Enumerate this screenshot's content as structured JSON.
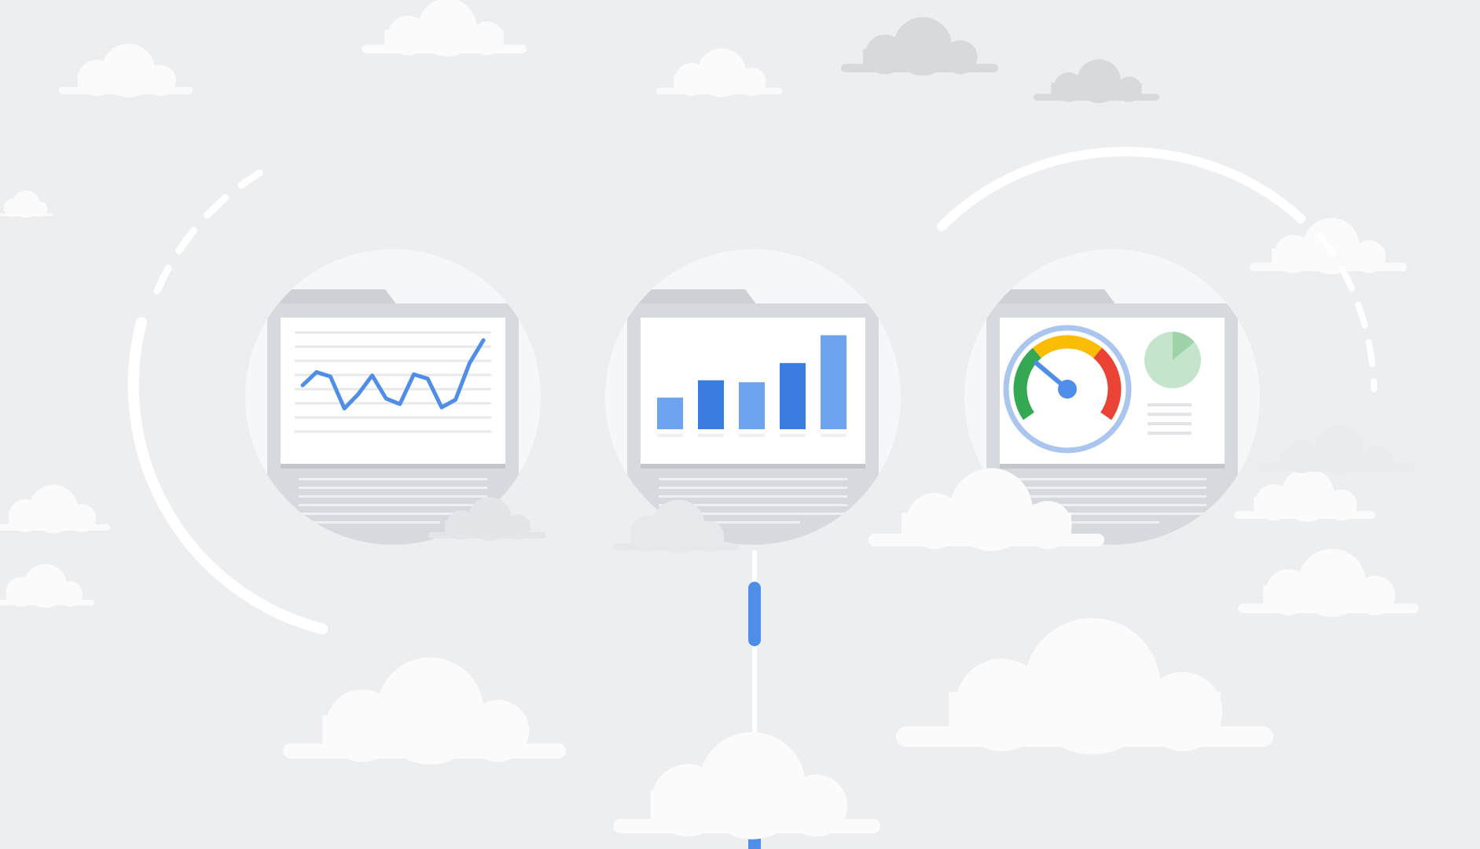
{
  "colors": {
    "background": "#edeef0",
    "cloud": "#fbfbfc",
    "cloud_shadow": "#dfe1e4",
    "cloud_dark": "#d7d9dc",
    "circle": "#f6f7f8",
    "folder_frame": "#d6d9dd",
    "folder_tab": "#cdd0d4",
    "screen": "#ffffff",
    "grid_line": "#e8e9eb",
    "text_line": "#e2e4e7",
    "blue": "#4f8ee8",
    "blue_dark": "#3a7be0",
    "blue_light": "#6ea3f0",
    "green": "#34a853",
    "yellow": "#fbbc04",
    "red": "#ea4335",
    "gauge_ring": "#aac6ee",
    "pie_light": "#c5e4cc",
    "pie_dark": "#9ed2a9",
    "arc": "#ffffff"
  },
  "icons": {
    "line_chart_panel": "line-chart-icon",
    "bar_chart_panel": "bar-chart-icon",
    "gauge_panel": "speedometer-gauge-icon",
    "connector": "vertical-connector-line"
  },
  "panels": [
    {
      "name": "line-chart-panel",
      "kind": "line"
    },
    {
      "name": "bar-chart-panel",
      "kind": "bar"
    },
    {
      "name": "gauge-panel",
      "kind": "gauge"
    }
  ],
  "line_chart": {
    "y_values": [
      5.2,
      6.4,
      6.0,
      3.1,
      4.4,
      6.1,
      4.0,
      3.5,
      6.2,
      5.8,
      3.2,
      3.9,
      7.2,
      9.3
    ]
  },
  "bar_chart": {
    "values": [
      3.3,
      5.1,
      4.9,
      6.9,
      9.8
    ]
  },
  "gauge": {
    "needle_fraction": 0.3,
    "pie_slice_fraction": 0.14
  }
}
